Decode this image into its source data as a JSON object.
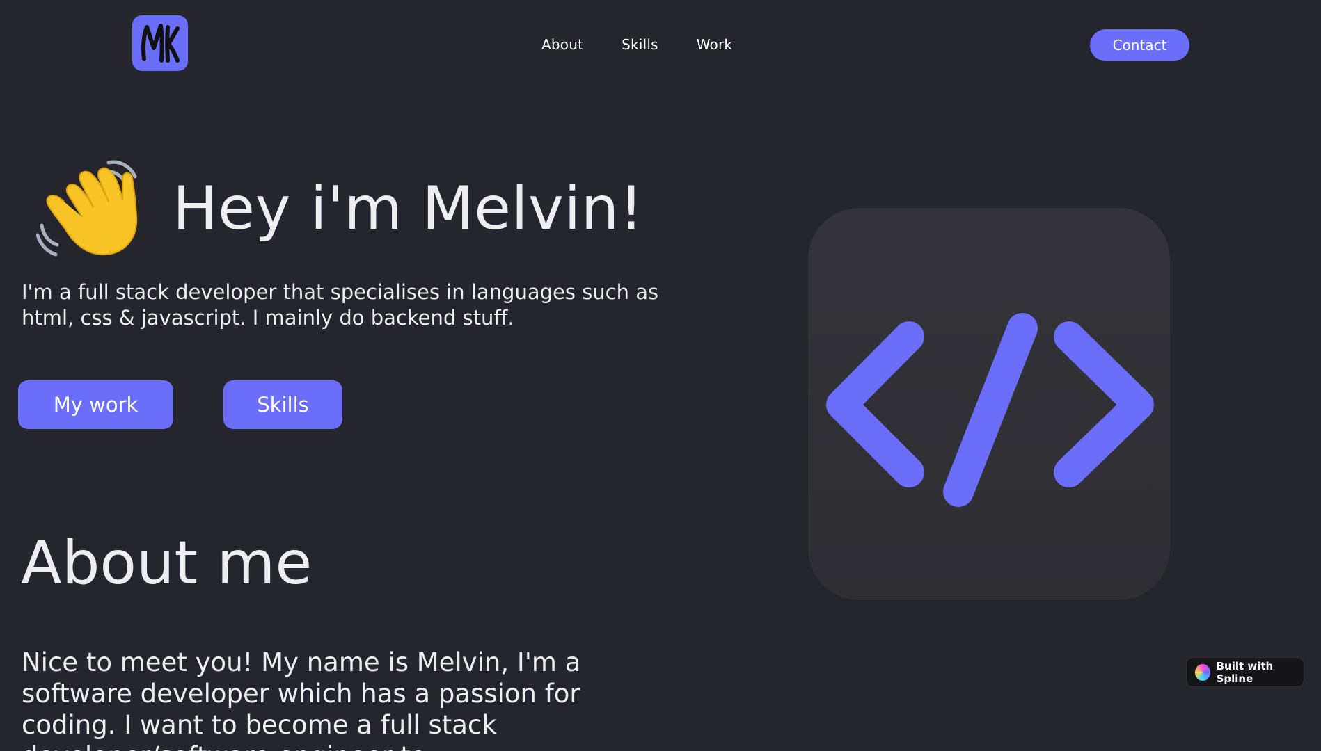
{
  "header": {
    "logo_text": "MK",
    "nav": [
      {
        "label": "About"
      },
      {
        "label": "Skills"
      },
      {
        "label": "Work"
      }
    ],
    "contact_label": "Contact"
  },
  "hero": {
    "emoji": "wave-emoji",
    "title": "Hey i'm Melvin!",
    "description": "I'm a full stack developer that specialises in languages such as html, css & javascript. I mainly do backend stuff.",
    "buttons": {
      "work_label": "My work",
      "skills_label": "Skills"
    }
  },
  "about": {
    "title": "About me",
    "text": "Nice to meet you! My name is Melvin, I'm a software developer which has a passion for coding. I want to become a full stack developer/software engineer to"
  },
  "code_card": {
    "icon": "code-brackets-icon"
  },
  "spline_badge": {
    "label": "Built with Spline"
  },
  "colors": {
    "background": "#25262d",
    "accent": "#6b6ef8",
    "card": "#333339"
  }
}
